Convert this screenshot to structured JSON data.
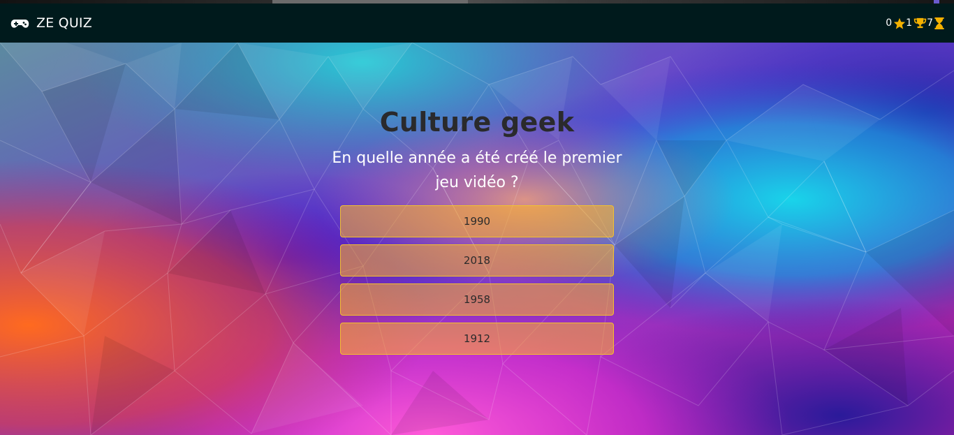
{
  "navbar": {
    "brand": "ZE QUIZ",
    "brand_icon": "gamepad-icon",
    "stats": {
      "stars": "0",
      "trophies": "1",
      "timer": "7",
      "icons": [
        "star-icon",
        "trophy-icon",
        "hourglass-icon"
      ]
    }
  },
  "quiz": {
    "category": "Culture geek",
    "question": "En quelle année a été créé le premier jeu vidéo ?",
    "answers": [
      "1990",
      "2018",
      "1958",
      "1912"
    ]
  },
  "colors": {
    "navbar_bg": "#001a1c",
    "accent": "#f5b100",
    "answer_border": "#f2c12e"
  }
}
